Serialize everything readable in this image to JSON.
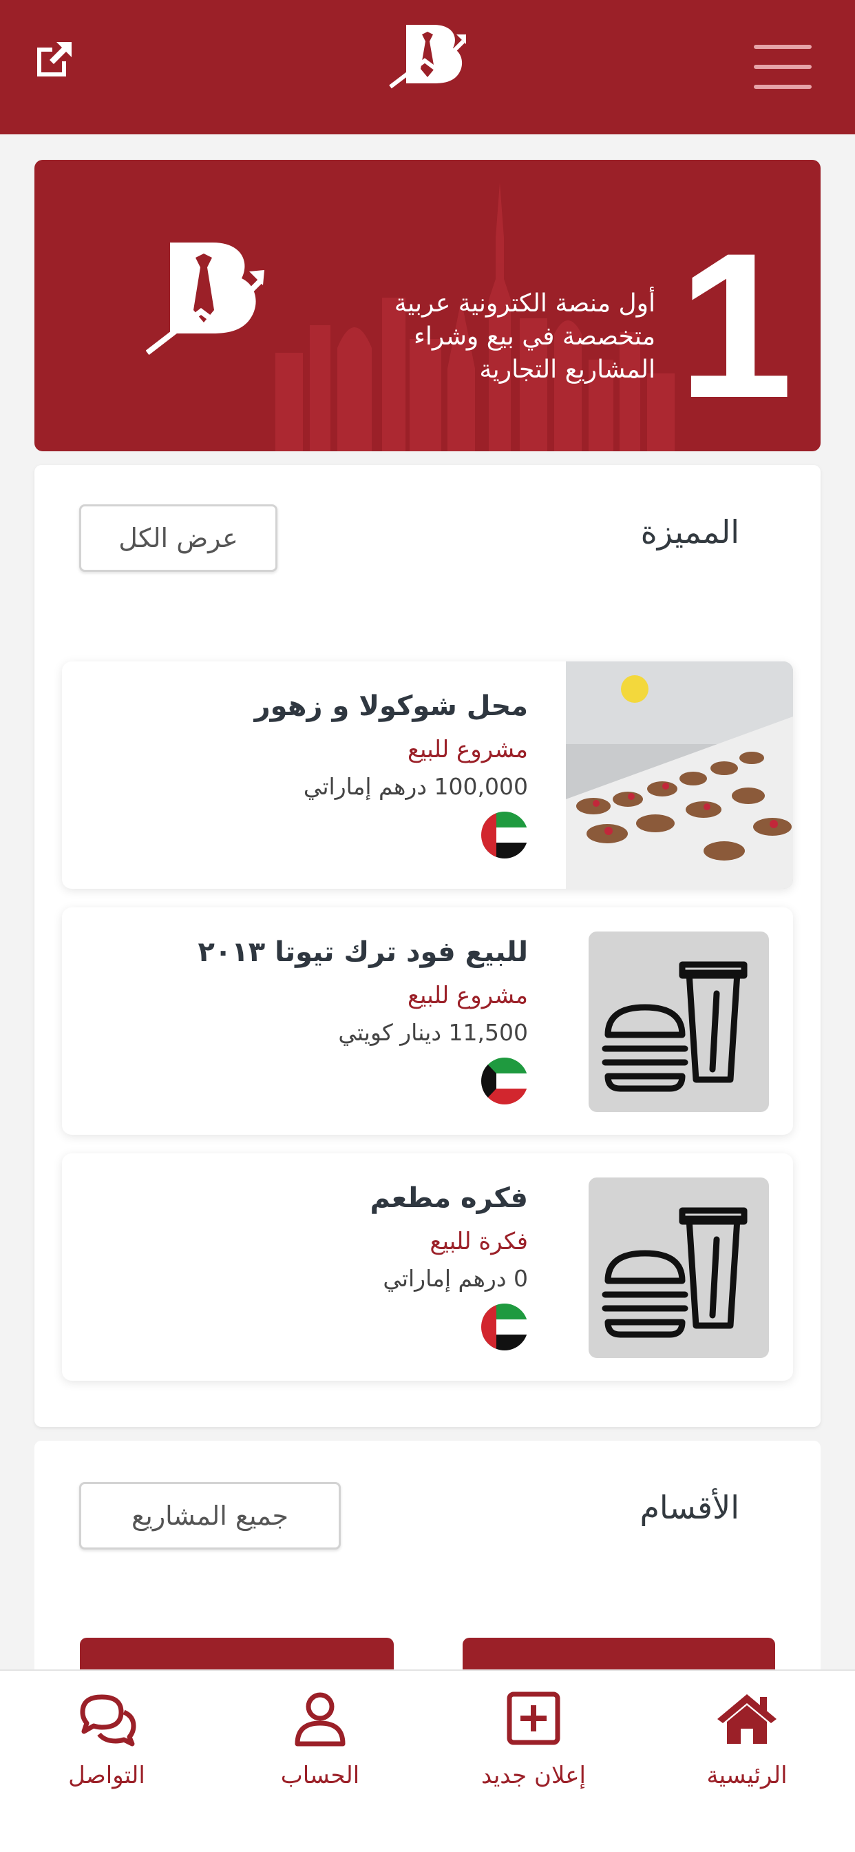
{
  "colors": {
    "brand": "#9b2028",
    "menu_lines": "#e6a3a8",
    "placeholder_bg": "#d4d4d4"
  },
  "header": {
    "external_link_icon": "external-link-icon",
    "logo_icon": "brand-logo-icon",
    "menu_icon": "hamburger-menu-icon"
  },
  "banner": {
    "line1": "أول منصة الكترونية عربية",
    "line2": "متخصصة في بيع وشراء",
    "line3": "المشاريع التجارية",
    "number": "1"
  },
  "featured": {
    "title": "المميزة",
    "view_all_label": "عرض الكل",
    "items": [
      {
        "title": "محل شوكولا و زهور",
        "type": "مشروع للبيع",
        "price": "100,000 درهم إماراتي",
        "flag": "uae-flag-icon",
        "image": "photo"
      },
      {
        "title": "للبيع فود ترك تيوتا ٢٠١٣",
        "type": "مشروع للبيع",
        "price": "11,500 دينار كويتي",
        "flag": "kuwait-flag-icon",
        "image": "food-placeholder-icon"
      },
      {
        "title": "فكره مطعم",
        "type": "فكرة للبيع",
        "price": "0 درهم إماراتي",
        "flag": "uae-flag-icon",
        "image": "food-placeholder-icon"
      }
    ]
  },
  "sections": {
    "title": "الأقسام",
    "all_projects_label": "جميع المشاريع"
  },
  "bottom_nav": [
    {
      "label": "التواصل",
      "icon": "chat-icon"
    },
    {
      "label": "الحساب",
      "icon": "user-icon"
    },
    {
      "label": "إعلان جديد",
      "icon": "plus-square-icon"
    },
    {
      "label": "الرئيسية",
      "icon": "home-icon"
    }
  ]
}
